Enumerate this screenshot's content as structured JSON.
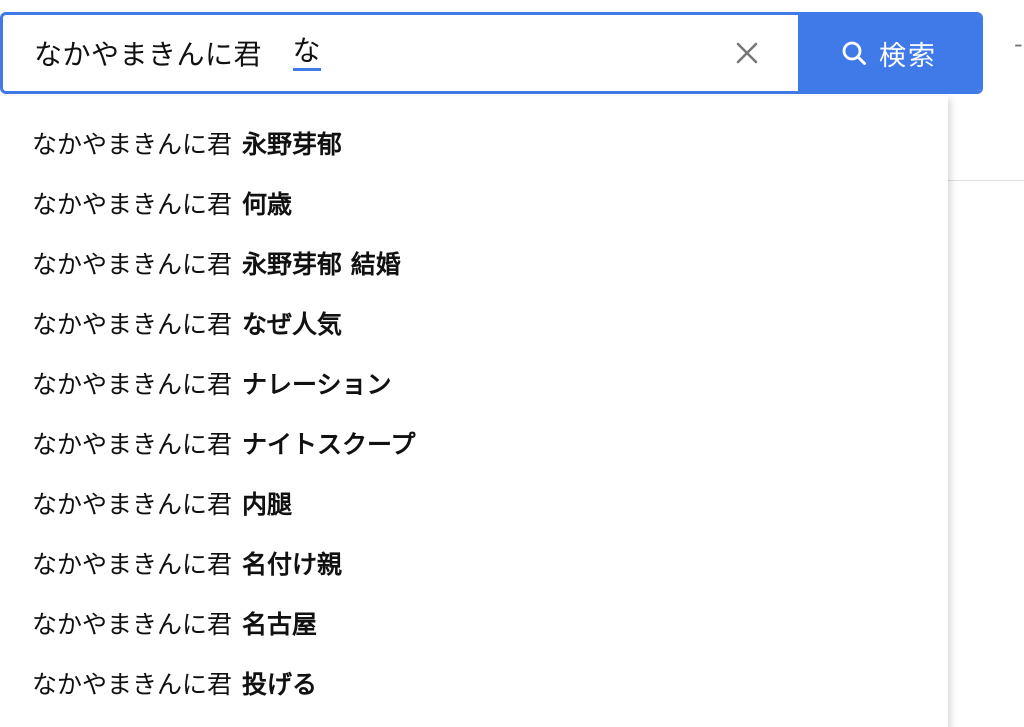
{
  "search": {
    "query": "なかやまきんに君　",
    "composing": "な",
    "button_label": "検索",
    "accent_color": "#3f7ae8"
  },
  "icons": {
    "clear": "close-icon",
    "search": "search-icon"
  },
  "suggestions": [
    {
      "base": "なかやまきんに君",
      "completion": "永野芽郁"
    },
    {
      "base": "なかやまきんに君",
      "completion": "何歳"
    },
    {
      "base": "なかやまきんに君",
      "completion": "永野芽郁 結婚"
    },
    {
      "base": "なかやまきんに君",
      "completion": "なぜ人気"
    },
    {
      "base": "なかやまきんに君",
      "completion": "ナレーション"
    },
    {
      "base": "なかやまきんに君",
      "completion": "ナイトスクープ"
    },
    {
      "base": "なかやまきんに君",
      "completion": "内腿"
    },
    {
      "base": "なかやまきんに君",
      "completion": "名付け親"
    },
    {
      "base": "なかやまきんに君",
      "completion": "名古屋"
    },
    {
      "base": "なかやまきんに君",
      "completion": "投げる"
    }
  ]
}
